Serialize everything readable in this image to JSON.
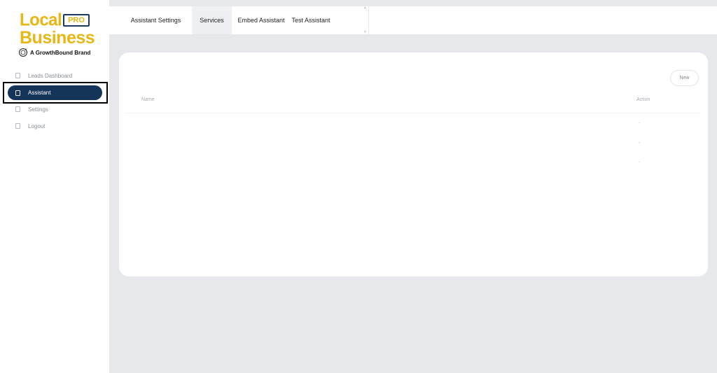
{
  "brand": {
    "local": "Local",
    "pro": "PRO",
    "business": "Business",
    "tagline": "A GrowthBound Brand"
  },
  "nav": {
    "items": [
      {
        "label": "Leads Dashboard",
        "active": false
      },
      {
        "label": "Assistant",
        "active": true
      },
      {
        "label": "Settings",
        "active": false
      },
      {
        "label": "Logout",
        "active": false
      }
    ]
  },
  "tabs": {
    "items": [
      {
        "label": "Assistant Settings",
        "active": false
      },
      {
        "label": "Services",
        "active": true
      },
      {
        "label": "Embed Assistant",
        "active": false
      },
      {
        "label": "Test Assistant",
        "active": false
      }
    ],
    "scroll_up": "˄",
    "scroll_down": "˅"
  },
  "services": {
    "new_label": "New",
    "columns": {
      "name": "Name",
      "action": "Action"
    },
    "rows": [
      {
        "name": "",
        "action": "-"
      },
      {
        "name": "",
        "action": "-"
      },
      {
        "name": "",
        "action": "-"
      }
    ]
  },
  "colors": {
    "accent": "#e8b714",
    "nav_active": "#15345a",
    "background": "#e6e8ec"
  }
}
